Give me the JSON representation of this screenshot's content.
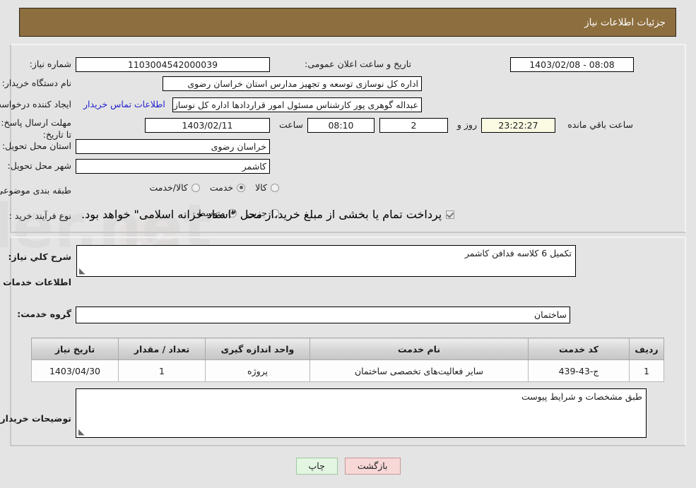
{
  "header": {
    "title": "جزئیات اطلاعات نیاز"
  },
  "form": {
    "need_number_label": "شماره نیاز:",
    "need_number_value": "1103004542000039",
    "public_announce_label": "تاریخ و ساعت اعلان عمومی:",
    "public_announce_value": "08:08 - 1403/02/08",
    "buyer_org_label": "نام دستگاه خریدار:",
    "buyer_org_value": "اداره کل نوسازی  توسعه و تجهیز مدارس استان خراسان رضوی",
    "creator_label": "ایجاد کننده درخواست:",
    "creator_value": "عبداله گوهری پور کارشناس مسئول امور قراردادها  اداره کل نوسازی  توسعه و ت",
    "contact_link": "اطلاعات تماس خریدار",
    "deadline_label": "مهلت ارسال پاسخ: تا تاریخ:",
    "deadline_date": "1403/02/11",
    "time_label": "ساعت",
    "deadline_time": "08:10",
    "days_value": "2",
    "days_sep": "روز و",
    "countdown_value": "23:22:27",
    "countdown_suffix": "ساعت باقي مانده",
    "province_label": "استان محل تحویل:",
    "province_value": "خراسان رضوی",
    "city_label": "شهر محل تحویل:",
    "city_value": "کاشمر",
    "category_label": "طبقه بندی موضوعی:",
    "category_options": [
      {
        "label": "کالا",
        "checked": false
      },
      {
        "label": "خدمت",
        "checked": true
      },
      {
        "label": "کالا/خدمت",
        "checked": false
      }
    ],
    "process_label": "نوع فرآیند خرید :",
    "process_options": [
      {
        "label": "جزیي",
        "checked": false
      },
      {
        "label": "متوسط",
        "checked": true
      }
    ],
    "treasury_checkbox_label": "پرداخت تمام یا بخشی از مبلغ خرید،از محل \"اسناد خزانه اسلامی\" خواهد بود.",
    "treasury_checked": true
  },
  "description": {
    "label": "شرح کلي نیاز:",
    "value": "تکمیل 6 کلاسه فدافن کاشمر"
  },
  "services": {
    "section_title": "اطلاعات خدمات مورد نیاز",
    "group_label": "گروه خدمت:",
    "group_value": "ساختمان",
    "columns": [
      "ردیف",
      "کد خدمت",
      "نام خدمت",
      "واحد اندازه گیری",
      "تعداد / مقدار",
      "تاریخ نیاز"
    ],
    "rows": [
      {
        "row_no": "1",
        "service_code": "ج-43-439",
        "service_name": "سایر فعالیت‌های تخصصی ساختمان",
        "unit": "پروژه",
        "quantity": "1",
        "need_date": "1403/04/30"
      }
    ]
  },
  "buyer_notes": {
    "label": "توضیحات خریدار:",
    "value": "طبق مشخصات و شرایط پیوست"
  },
  "buttons": {
    "back": "بازگشت",
    "print": "چاپ"
  },
  "colors": {
    "header_brown": "#8d6e3e",
    "page_bg": "#e4e4e4",
    "link_blue": "#2222cc",
    "back_btn": "#f8d7d7",
    "print_btn": "#e2f6e2",
    "countdown_bg": "#fbfbe4"
  }
}
